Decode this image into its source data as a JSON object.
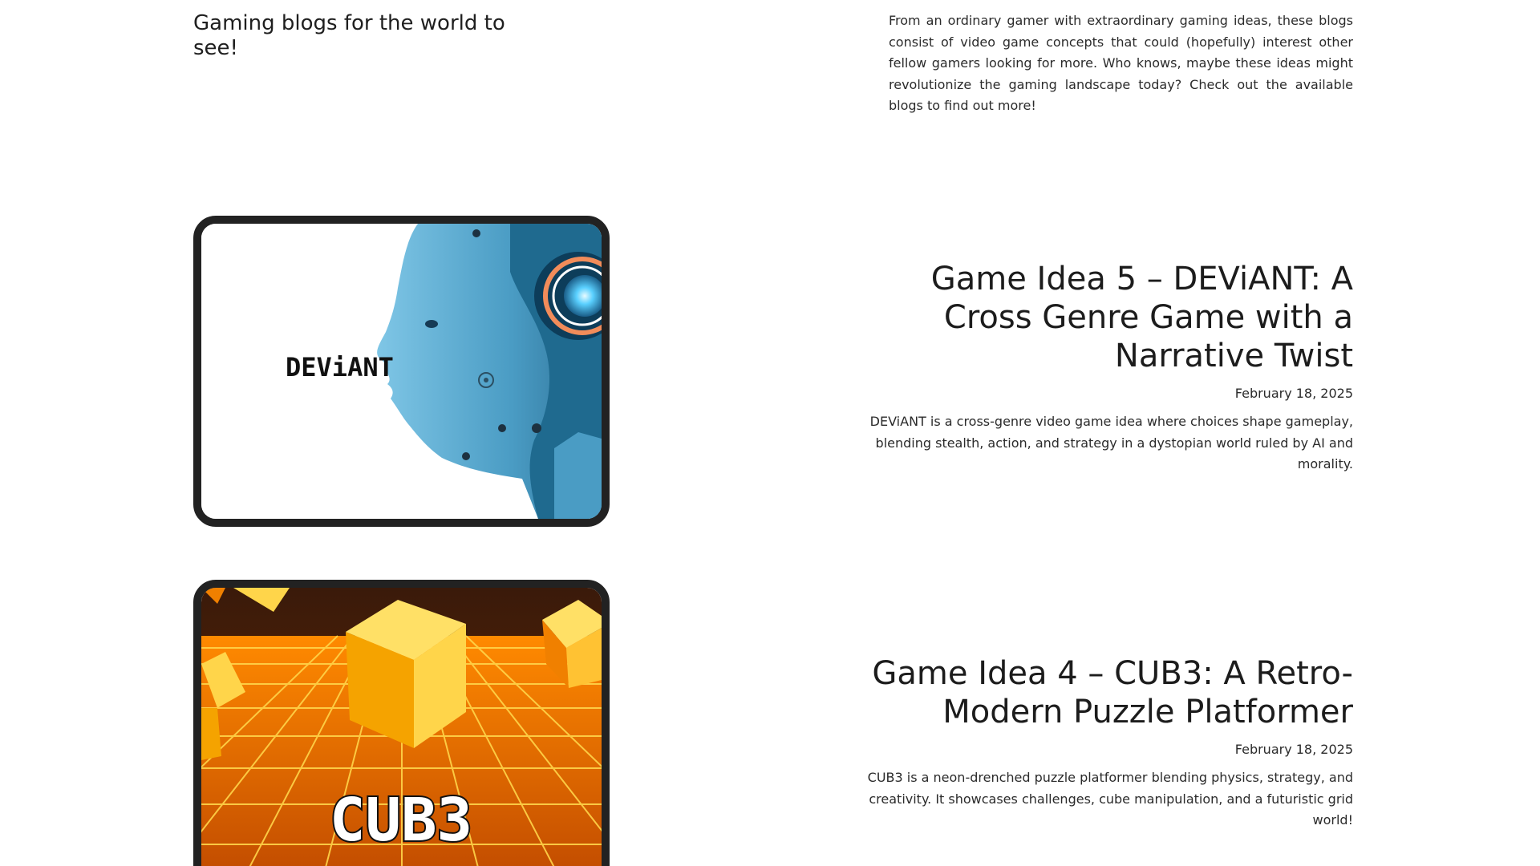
{
  "hero": {
    "heading": "Gaming blogs for the world to see!",
    "description": "From an ordinary gamer with extraordinary gaming ideas, these blogs consist of video game concepts that could (hopefully) interest other fellow gamers looking for more. Who knows, maybe these ideas might revolutionize the gaming landscape today? Check out the available blogs to find out more!"
  },
  "posts": [
    {
      "thumb_text": "DEViANT",
      "title": "Game Idea 5 – DEViANT: A Cross Genre Game with a Narrative Twist",
      "date": "February 18, 2025",
      "excerpt": "DEViANT is a cross-genre video game idea where choices shape gameplay, blending stealth, action, and strategy in a dystopian world ruled by AI and morality."
    },
    {
      "thumb_text": "CUB3",
      "title": "Game Idea 4 – CUB3: A Retro-Modern Puzzle Platformer",
      "date": "February 18, 2025",
      "excerpt": "CUB3 is a neon-drenched puzzle platformer blending physics, strategy, and creativity. It showcases challenges, cube manipulation, and a futuristic grid world!"
    }
  ],
  "colors": {
    "text": "#222222",
    "frame": "#222222",
    "robot_blue": "#4a9cc4",
    "neon_orange": "#f5a300",
    "cube_yellow": "#ffd54a"
  }
}
